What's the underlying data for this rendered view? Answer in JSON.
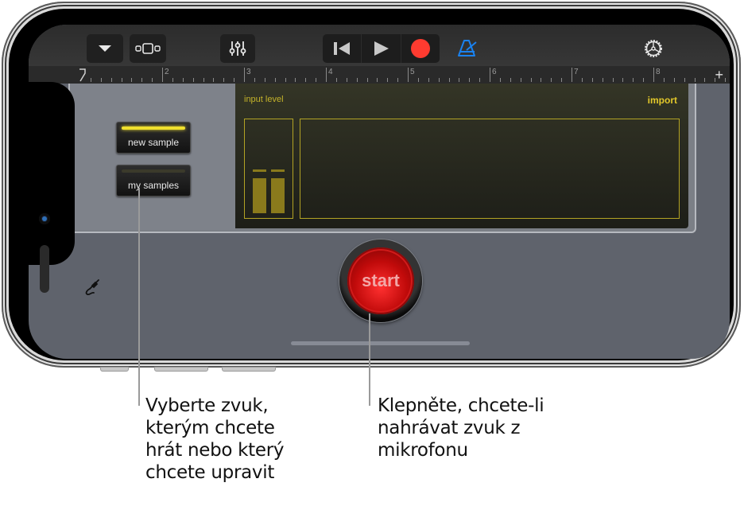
{
  "toolbar": {
    "buttons": [
      {
        "name": "browser",
        "icon": "triangle-down-icon"
      },
      {
        "name": "view",
        "icon": "view-toggle-icon"
      },
      {
        "name": "mixer",
        "icon": "sliders-icon"
      }
    ],
    "transport": [
      {
        "name": "go-to-beginning",
        "icon": "skip-back-icon"
      },
      {
        "name": "play",
        "icon": "play-icon"
      },
      {
        "name": "record",
        "icon": "record-icon",
        "color": "#ff3b30"
      }
    ],
    "metronome": {
      "icon": "metronome-icon",
      "color": "#1a82f0"
    },
    "settings": {
      "icon": "gear-icon"
    }
  },
  "ruler": {
    "bars": [
      "2",
      "3",
      "4",
      "5",
      "6",
      "7",
      "8"
    ],
    "add_label": "+"
  },
  "sampler": {
    "new_sample_label": "new sample",
    "new_sample_led": "on",
    "my_samples_label": "my samples",
    "my_samples_led": "off",
    "input_level_label": "input level",
    "import_label": "import",
    "accent_color": "#e3c82a"
  },
  "start_button": {
    "label": "start",
    "color": "#d41212"
  },
  "input_icon": "audio-input-jack-icon",
  "callouts": [
    {
      "lines": [
        "Vyberte zvuk,",
        "kterým chcete",
        "hrát nebo který",
        "chcete upravit"
      ]
    },
    {
      "lines": [
        "Klepněte, chcete-li",
        "nahrávat zvuk z",
        "mikrofonu"
      ]
    }
  ]
}
